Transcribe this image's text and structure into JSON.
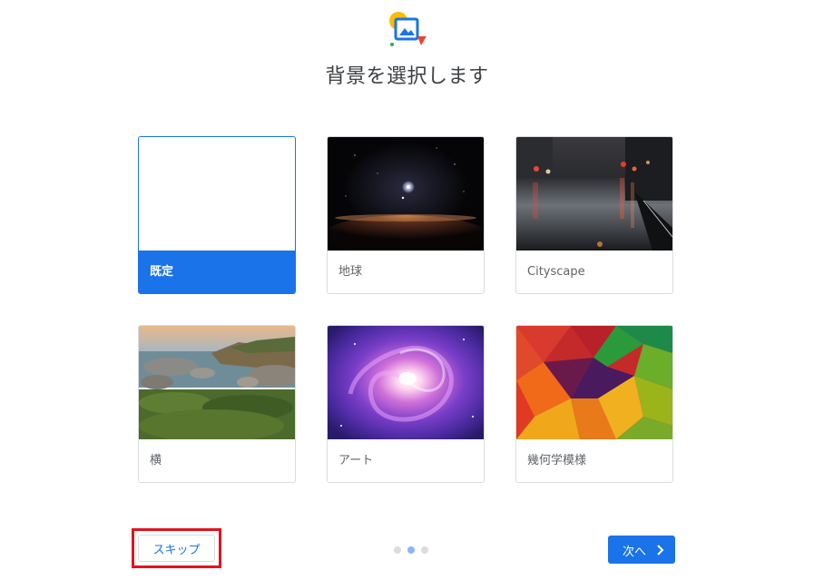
{
  "header": {
    "title": "背景を選択します",
    "icon": "wallpaper-icon"
  },
  "backgrounds": [
    {
      "label": "既定",
      "selected": true,
      "thumb": "blank"
    },
    {
      "label": "地球",
      "selected": false,
      "thumb": "earth-horizon-image"
    },
    {
      "label": "Cityscape",
      "selected": false,
      "thumb": "rainy-street-image"
    },
    {
      "label": "横",
      "selected": false,
      "thumb": "rocky-coast-image"
    },
    {
      "label": "アート",
      "selected": false,
      "thumb": "purple-galaxy-image"
    },
    {
      "label": "幾何学模様",
      "selected": false,
      "thumb": "polygon-pattern-image"
    }
  ],
  "footer": {
    "skip_label": "スキップ",
    "next_label": "次へ",
    "pagination": {
      "total": 3,
      "current": 2
    }
  },
  "colors": {
    "accent": "#1a73e8",
    "highlight": "#e3121f",
    "dot_active": "#8ab4f8",
    "dot_inactive": "#dadce0"
  }
}
